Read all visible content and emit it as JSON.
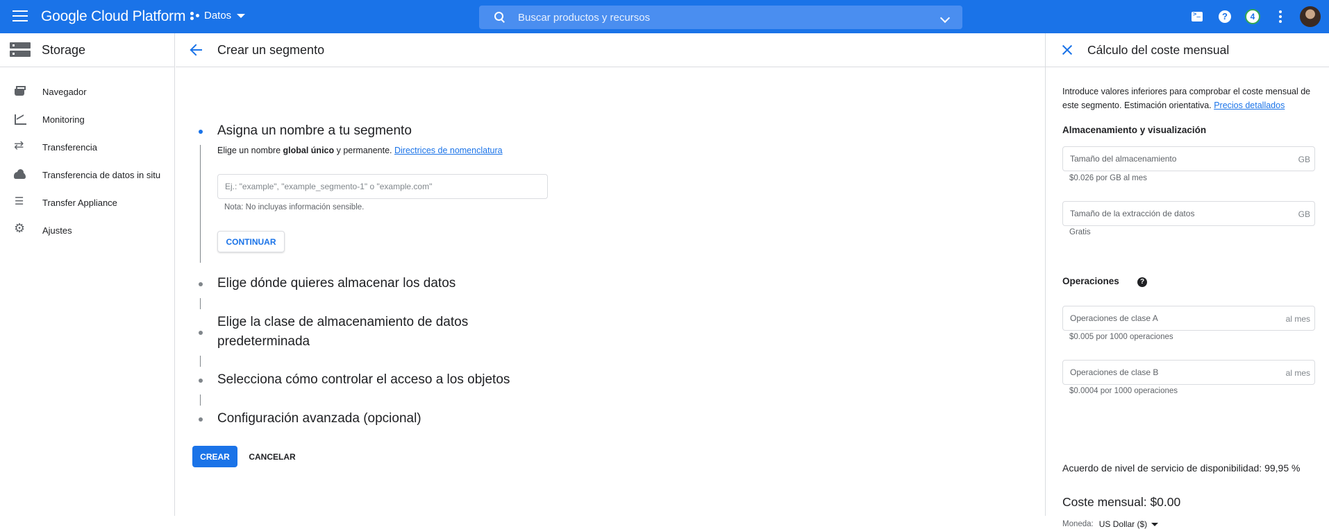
{
  "topbar": {
    "brand": "Google Cloud Platform",
    "project": "Datos",
    "search_placeholder": "Buscar productos y recursos",
    "notification_count": "4"
  },
  "sidebar": {
    "title": "Storage",
    "items": [
      {
        "label": "Navegador",
        "icon": "basket-icon"
      },
      {
        "label": "Monitoring",
        "icon": "chart-icon"
      },
      {
        "label": "Transferencia",
        "icon": "swap-icon"
      },
      {
        "label": "Transferencia de datos in situ",
        "icon": "cloud-upload-icon"
      },
      {
        "label": "Transfer Appliance",
        "icon": "list-icon"
      },
      {
        "label": "Ajustes",
        "icon": "gear-icon"
      }
    ]
  },
  "main": {
    "title": "Crear un segmento",
    "steps": [
      {
        "title": "Asigna un nombre a tu segmento"
      },
      {
        "title": "Elige dónde quieres almacenar los datos"
      },
      {
        "title_line1": "Elige la clase de almacenamiento de datos",
        "title_line2": "predeterminada"
      },
      {
        "title": "Selecciona cómo controlar el acceso a los objetos"
      },
      {
        "title": "Configuración avanzada (opcional)"
      }
    ],
    "sub_pre": "Elige un nombre ",
    "sub_bold": "global único",
    "sub_post": " y permanente. ",
    "sub_link": "Directrices de nomenclatura",
    "name_placeholder": "Ej.: \"example\", \"example_segmento-1\" o \"example.com\"",
    "note": "Nota: No incluyas información sensible.",
    "continue_label": "CONTINUAR",
    "create_label": "CREAR",
    "cancel_label": "CANCELAR"
  },
  "panel": {
    "title": "Cálculo del coste mensual",
    "intro": "Introduce valores inferiores para comprobar el coste mensual de este segmento. Estimación orientativa.",
    "intro_link": "Precios detallados",
    "storage_section": "Almacenamiento y visualización",
    "storage_size_label": "Tamaño del almacenamiento",
    "storage_size_unit": "GB",
    "storage_size_hint": "$0.026 por GB al mes",
    "egress_label": "Tamaño de la extracción de datos",
    "egress_unit": "GB",
    "egress_hint": "Gratis",
    "ops_section": "Operaciones",
    "class_a_label": "Operaciones de clase A",
    "class_a_unit": "al mes",
    "class_a_hint": "$0.005 por 1000 operaciones",
    "class_b_label": "Operaciones de clase B",
    "class_b_unit": "al mes",
    "class_b_hint": "$0.0004 por 1000 operaciones",
    "sla": "Acuerdo de nivel de servicio de disponibilidad: 99,95 %",
    "cost": "Coste mensual: $0.00",
    "currency_label": "Moneda:",
    "currency_value": "US Dollar ($)"
  },
  "colors": {
    "primary": "#1a73e8",
    "text": "#202124",
    "secondary_text": "#5f6368",
    "border": "#dadce0"
  }
}
